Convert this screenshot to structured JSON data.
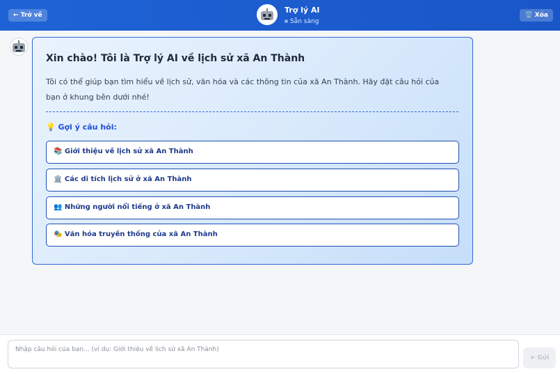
{
  "header": {
    "back_label": "← Trở về",
    "title": "Trợ lý AI",
    "status": "Sẵn sàng",
    "clear_label": "🗑️ Xóa",
    "avatar_icon": "robot-icon"
  },
  "message": {
    "title": "Xin chào! Tôi là Trợ lý AI về lịch sử xã An Thành",
    "body": "Tôi có thể giúp bạn tìm hiểu về lịch sử, văn hóa và các thông tin của xã An Thành. Hãy đặt câu hỏi của bạn ở khung bên dưới nhé!",
    "suggestions_heading": "💡 Gợi ý câu hỏi:",
    "suggestions": [
      "📚 Giới thiệu về lịch sử xã An Thành",
      "🏛️ Các di tích lịch sử ở xã An Thành",
      "👥 Những người nổi tiếng ở xã An Thành",
      "🎭 Văn hóa truyền thống của xã An Thành"
    ]
  },
  "composer": {
    "placeholder": "Nhập câu hỏi của bạn... (ví dụ: Giới thiệu về lịch sử xã An Thành)",
    "value": "",
    "send_label": "➤ Gửi"
  },
  "colors": {
    "header": "#1e63d6",
    "accent": "#2f6ad6",
    "suggestion_text": "#1d3a8a"
  }
}
